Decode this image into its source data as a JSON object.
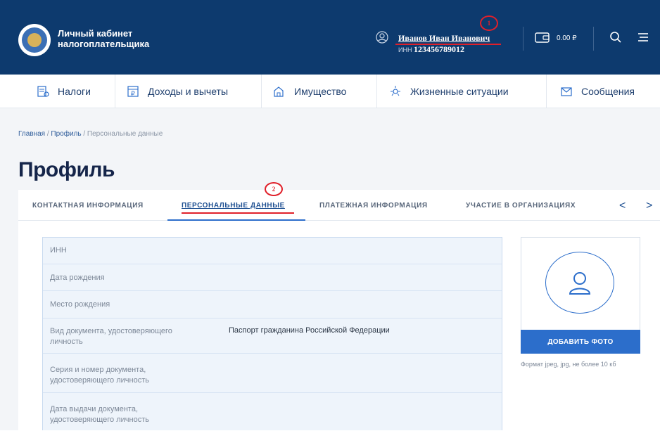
{
  "header": {
    "brand_line1": "Личный кабинет",
    "brand_line2": "налогоплательщика",
    "user_name": "Иванов Иван Иванович",
    "inn_label": "ИНН",
    "inn_value": "123456789012",
    "balance": "0.00 ₽",
    "marker1": "1",
    "icons": [
      "fns-emblem-icon",
      "user-icon",
      "wallet-icon",
      "search-icon",
      "menu-icon"
    ],
    "background": "#0d3a6e"
  },
  "nav": {
    "items": [
      {
        "label": "Налоги",
        "icon": "taxes-icon"
      },
      {
        "label": "Доходы и вычеты",
        "icon": "income-icon"
      },
      {
        "label": "Имущество",
        "icon": "property-icon"
      },
      {
        "label": "Жизненные ситуации",
        "icon": "life-situations-icon"
      },
      {
        "label": "Сообщения",
        "icon": "messages-icon"
      }
    ]
  },
  "breadcrumb": {
    "home": "Главная",
    "sep1": " / ",
    "profile": "Профиль",
    "sep2": " / ",
    "current": "Персональные данные"
  },
  "page_title": "Профиль",
  "tabs": {
    "items": [
      {
        "label": "КОНТАКТНАЯ ИНФОРМАЦИЯ",
        "active": false
      },
      {
        "label": "ПЕРСОНАЛЬНЫЕ ДАННЫЕ",
        "active": true
      },
      {
        "label": "ПЛАТЕЖНАЯ ИНФОРМАЦИЯ",
        "active": false
      },
      {
        "label": "УЧАСТИЕ В ОРГАНИЗАЦИЯХ",
        "active": false
      }
    ],
    "prev": "<",
    "next": ">",
    "marker2": "2"
  },
  "form": {
    "rows": [
      {
        "label": "ИНН",
        "value": ""
      },
      {
        "label": "Дата рождения",
        "value": ""
      },
      {
        "label": "Место рождения",
        "value": ""
      },
      {
        "label_line1": "Вид документа, удостоверяющего",
        "label_line2": "личность",
        "value": "Паспорт гражданина Российской Федерации"
      },
      {
        "label_line1": "Серия и номер документа,",
        "label_line2": "удостоверяющего личность",
        "value": ""
      },
      {
        "label_line1": "Дата выдачи документа,",
        "label_line2": "удостоверяющего личность",
        "value": ""
      }
    ]
  },
  "photo": {
    "button": "ДОБАВИТЬ ФОТО",
    "hint": "Формат jpeg, jpg, не более 10 кб"
  },
  "colors": {
    "accent": "#2c6ecb",
    "annotation_red": "#e0202a"
  }
}
